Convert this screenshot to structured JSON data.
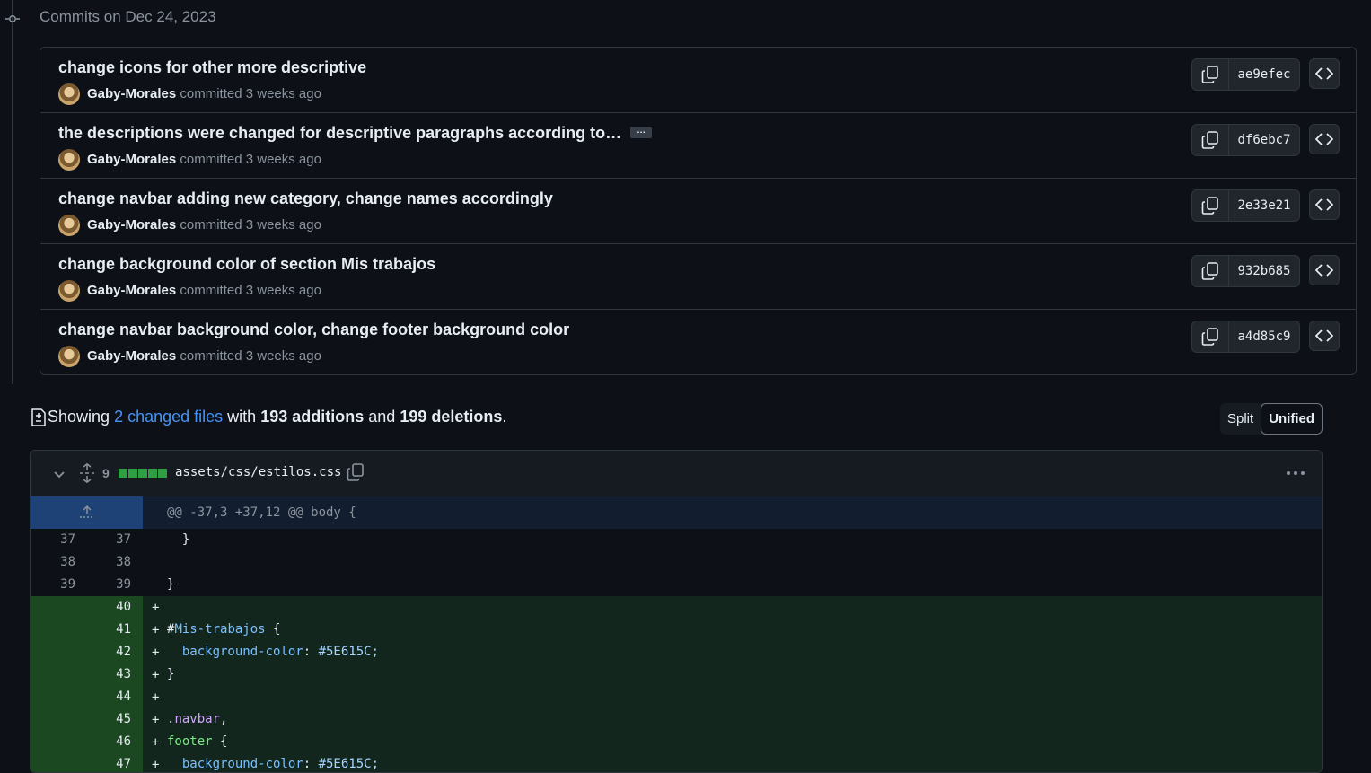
{
  "timeline": {
    "date_heading": "Commits on Dec 24, 2023"
  },
  "commits": [
    {
      "title": "change icons for other more descriptive",
      "author": "Gaby-Morales",
      "meta": "committed 3 weeks ago",
      "sha": "ae9efec",
      "truncated": false
    },
    {
      "title": "the descriptions were changed for descriptive paragraphs according to…",
      "author": "Gaby-Morales",
      "meta": "committed 3 weeks ago",
      "sha": "df6ebc7",
      "truncated": true,
      "ellipsis_label": "…"
    },
    {
      "title": "change navbar adding new category, change names accordingly",
      "author": "Gaby-Morales",
      "meta": "committed 3 weeks ago",
      "sha": "2e33e21",
      "truncated": false
    },
    {
      "title": "change background color of section Mis trabajos",
      "author": "Gaby-Morales",
      "meta": "committed 3 weeks ago",
      "sha": "932b685",
      "truncated": false
    },
    {
      "title": "change navbar background color, change footer background color",
      "author": "Gaby-Morales",
      "meta": "committed 3 weeks ago",
      "sha": "a4d85c9",
      "truncated": false
    }
  ],
  "summary": {
    "prefix": "Showing",
    "changed_files": "2 changed files",
    "with": "with",
    "additions": "193 additions",
    "and": "and",
    "deletions": "199 deletions",
    "suffix": "."
  },
  "view_toggle": {
    "split": "Split",
    "unified": "Unified",
    "selected": "Unified"
  },
  "file": {
    "change_count": "9",
    "diffstat_blocks": 5,
    "path": "assets/css/estilos.css",
    "hunk_header": "@@ -37,3 +37,12 @@ body {",
    "lines": [
      {
        "old": "37",
        "new": "37",
        "sign": "",
        "code": "  }",
        "type": "context"
      },
      {
        "old": "38",
        "new": "38",
        "sign": "",
        "code": "",
        "type": "context"
      },
      {
        "old": "39",
        "new": "39",
        "sign": "",
        "code": "}",
        "type": "context"
      },
      {
        "old": "",
        "new": "40",
        "sign": "+",
        "code": "",
        "type": "add"
      },
      {
        "old": "",
        "new": "41",
        "sign": "+",
        "code": "#Mis-trabajos {",
        "type": "add"
      },
      {
        "old": "",
        "new": "42",
        "sign": "+",
        "code": "  background-color: #5E615C;",
        "type": "add"
      },
      {
        "old": "",
        "new": "43",
        "sign": "+",
        "code": "}",
        "type": "add"
      },
      {
        "old": "",
        "new": "44",
        "sign": "+",
        "code": "",
        "type": "add"
      },
      {
        "old": "",
        "new": "45",
        "sign": "+",
        "code": ".navbar,",
        "type": "add"
      },
      {
        "old": "",
        "new": "46",
        "sign": "+",
        "code": "footer {",
        "type": "add"
      },
      {
        "old": "",
        "new": "47",
        "sign": "+",
        "code": "  background-color: #5E615C;",
        "type": "add"
      }
    ]
  },
  "colors": {
    "background": "#0d1117",
    "border": "#30363d",
    "link": "#4493f8",
    "addition_bg": "#12261e",
    "addition_gutter": "#1b4721",
    "hunk_bg": "#121d2f"
  }
}
